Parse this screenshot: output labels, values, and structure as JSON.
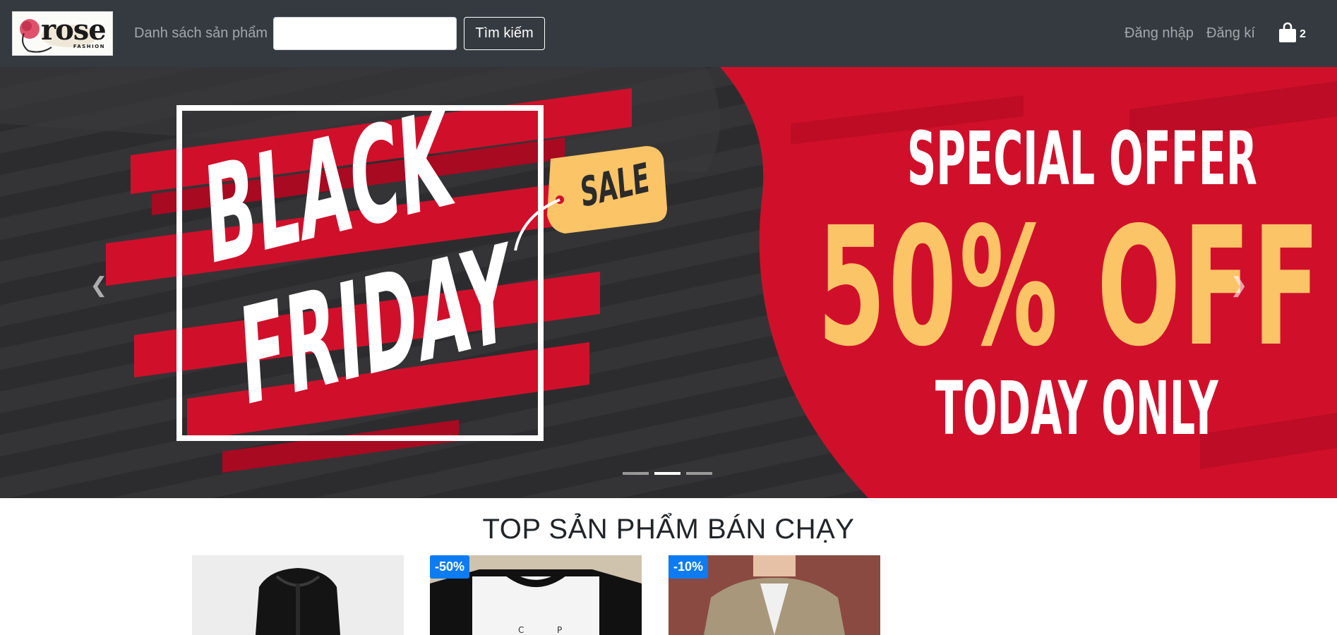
{
  "navbar": {
    "logo": {
      "brand": "rose",
      "tagline": "FASHION"
    },
    "products_link": "Danh sách sản phẩm",
    "search": {
      "value": "",
      "placeholder": "",
      "button_label": "Tìm kiếm"
    },
    "login_link": "Đăng nhập",
    "register_link": "Đăng kí",
    "cart": {
      "icon": "shopping-bag-icon",
      "count": "2"
    }
  },
  "carousel": {
    "slide": {
      "line1": "BLACK",
      "line2": "FRIDAY",
      "tag": "SALE",
      "offer_heading": "SPECIAL OFFER",
      "offer_value": "50% OFF",
      "offer_footer": "TODAY ONLY"
    },
    "prev_icon": "chevron-left-icon",
    "next_icon": "chevron-right-icon",
    "indicator_count": 3,
    "active_indicator": 2
  },
  "section": {
    "title": "TOP SẢN PHẨM BÁN CHẠY",
    "products": [
      {
        "badge": ""
      },
      {
        "badge": "-50%"
      },
      {
        "badge": "-10%"
      }
    ]
  },
  "colors": {
    "navbar_bg": "#343a40",
    "banner_red": "#d0102b",
    "banner_yellow": "#fbc466",
    "badge_blue": "#0d7cf2"
  }
}
